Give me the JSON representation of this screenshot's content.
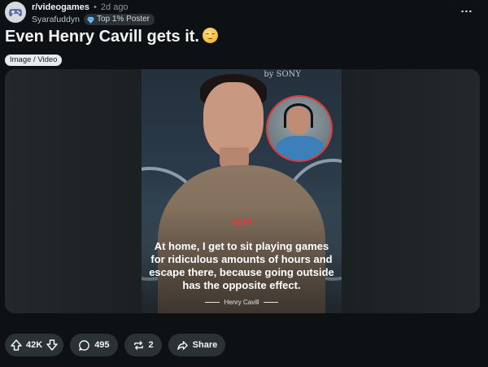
{
  "post": {
    "subreddit": "r/videogames",
    "separator": "•",
    "age": "2d ago",
    "author": "Syarafuddyn",
    "badge": "Top 1% Poster",
    "title": "Even Henry Cavill gets it.",
    "flair": "Image / Video",
    "overflow_label": "..."
  },
  "media": {
    "brand_text": "by SONY",
    "quote_mark": "“”",
    "quote": "At home, I get to sit playing games for ridiculous amounts of hours and escape there, because going outside has the opposite effect.",
    "attribution": "Henry Cavill"
  },
  "actions": {
    "upvotes": "42K",
    "comments": "495",
    "crossposts": "2",
    "share": "Share"
  },
  "icons": {
    "subreddit_avatar": "controller-icon",
    "badge": "diamond-icon",
    "upvote": "arrow-up-icon",
    "downvote": "arrow-down-icon",
    "comments": "speech-bubble-icon",
    "crosspost": "repeat-icon",
    "share": "share-arrow-icon"
  },
  "colors": {
    "background": "#0e1113",
    "pill": "#2a3236",
    "quote_accent": "#e03a3a",
    "flair_bg": "#e5ebee"
  }
}
